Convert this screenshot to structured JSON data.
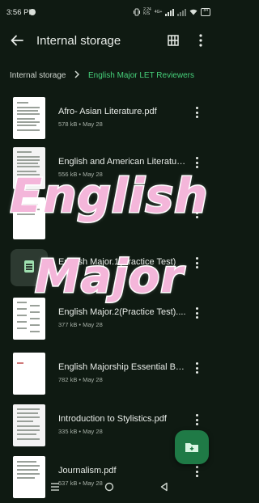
{
  "status": {
    "time": "3:56 PM",
    "net_speed": "2.24",
    "net_unit": "K/S",
    "net_type": "4G+",
    "battery": "84"
  },
  "header": {
    "title": "Internal storage"
  },
  "breadcrumb": {
    "root": "Internal storage",
    "current": "English Major LET Reviewers"
  },
  "files": [
    {
      "name": "Afro- Asian Literature.pdf",
      "meta": "578 kB • May 28"
    },
    {
      "name": "English and American Literatur...",
      "meta": "556 kB • May 28"
    },
    {
      "name": "",
      "meta": ""
    },
    {
      "name": "English Major.1(Practice Test)",
      "meta": ""
    },
    {
      "name": "English Major.2(Practice Test)....",
      "meta": "377 kB • May 28"
    },
    {
      "name": "English Majorship Essential Bul...",
      "meta": "782 kB • May 28"
    },
    {
      "name": "Introduction to Stylistics.pdf",
      "meta": "335 kB • May 28"
    },
    {
      "name": "Journalism.pdf",
      "meta": "537 kB • May 28"
    }
  ],
  "overlay": {
    "line1": "English",
    "line2": "Major"
  },
  "colors": {
    "background": "#0f1a12",
    "accent": "#46d07a",
    "fab": "#1f7a46",
    "overlay_fill": "#f4b6da"
  },
  "icons": {
    "back": "arrow-left-icon",
    "grid": "grid-view-icon",
    "more": "more-vert-icon",
    "fab": "create-folder-icon"
  }
}
